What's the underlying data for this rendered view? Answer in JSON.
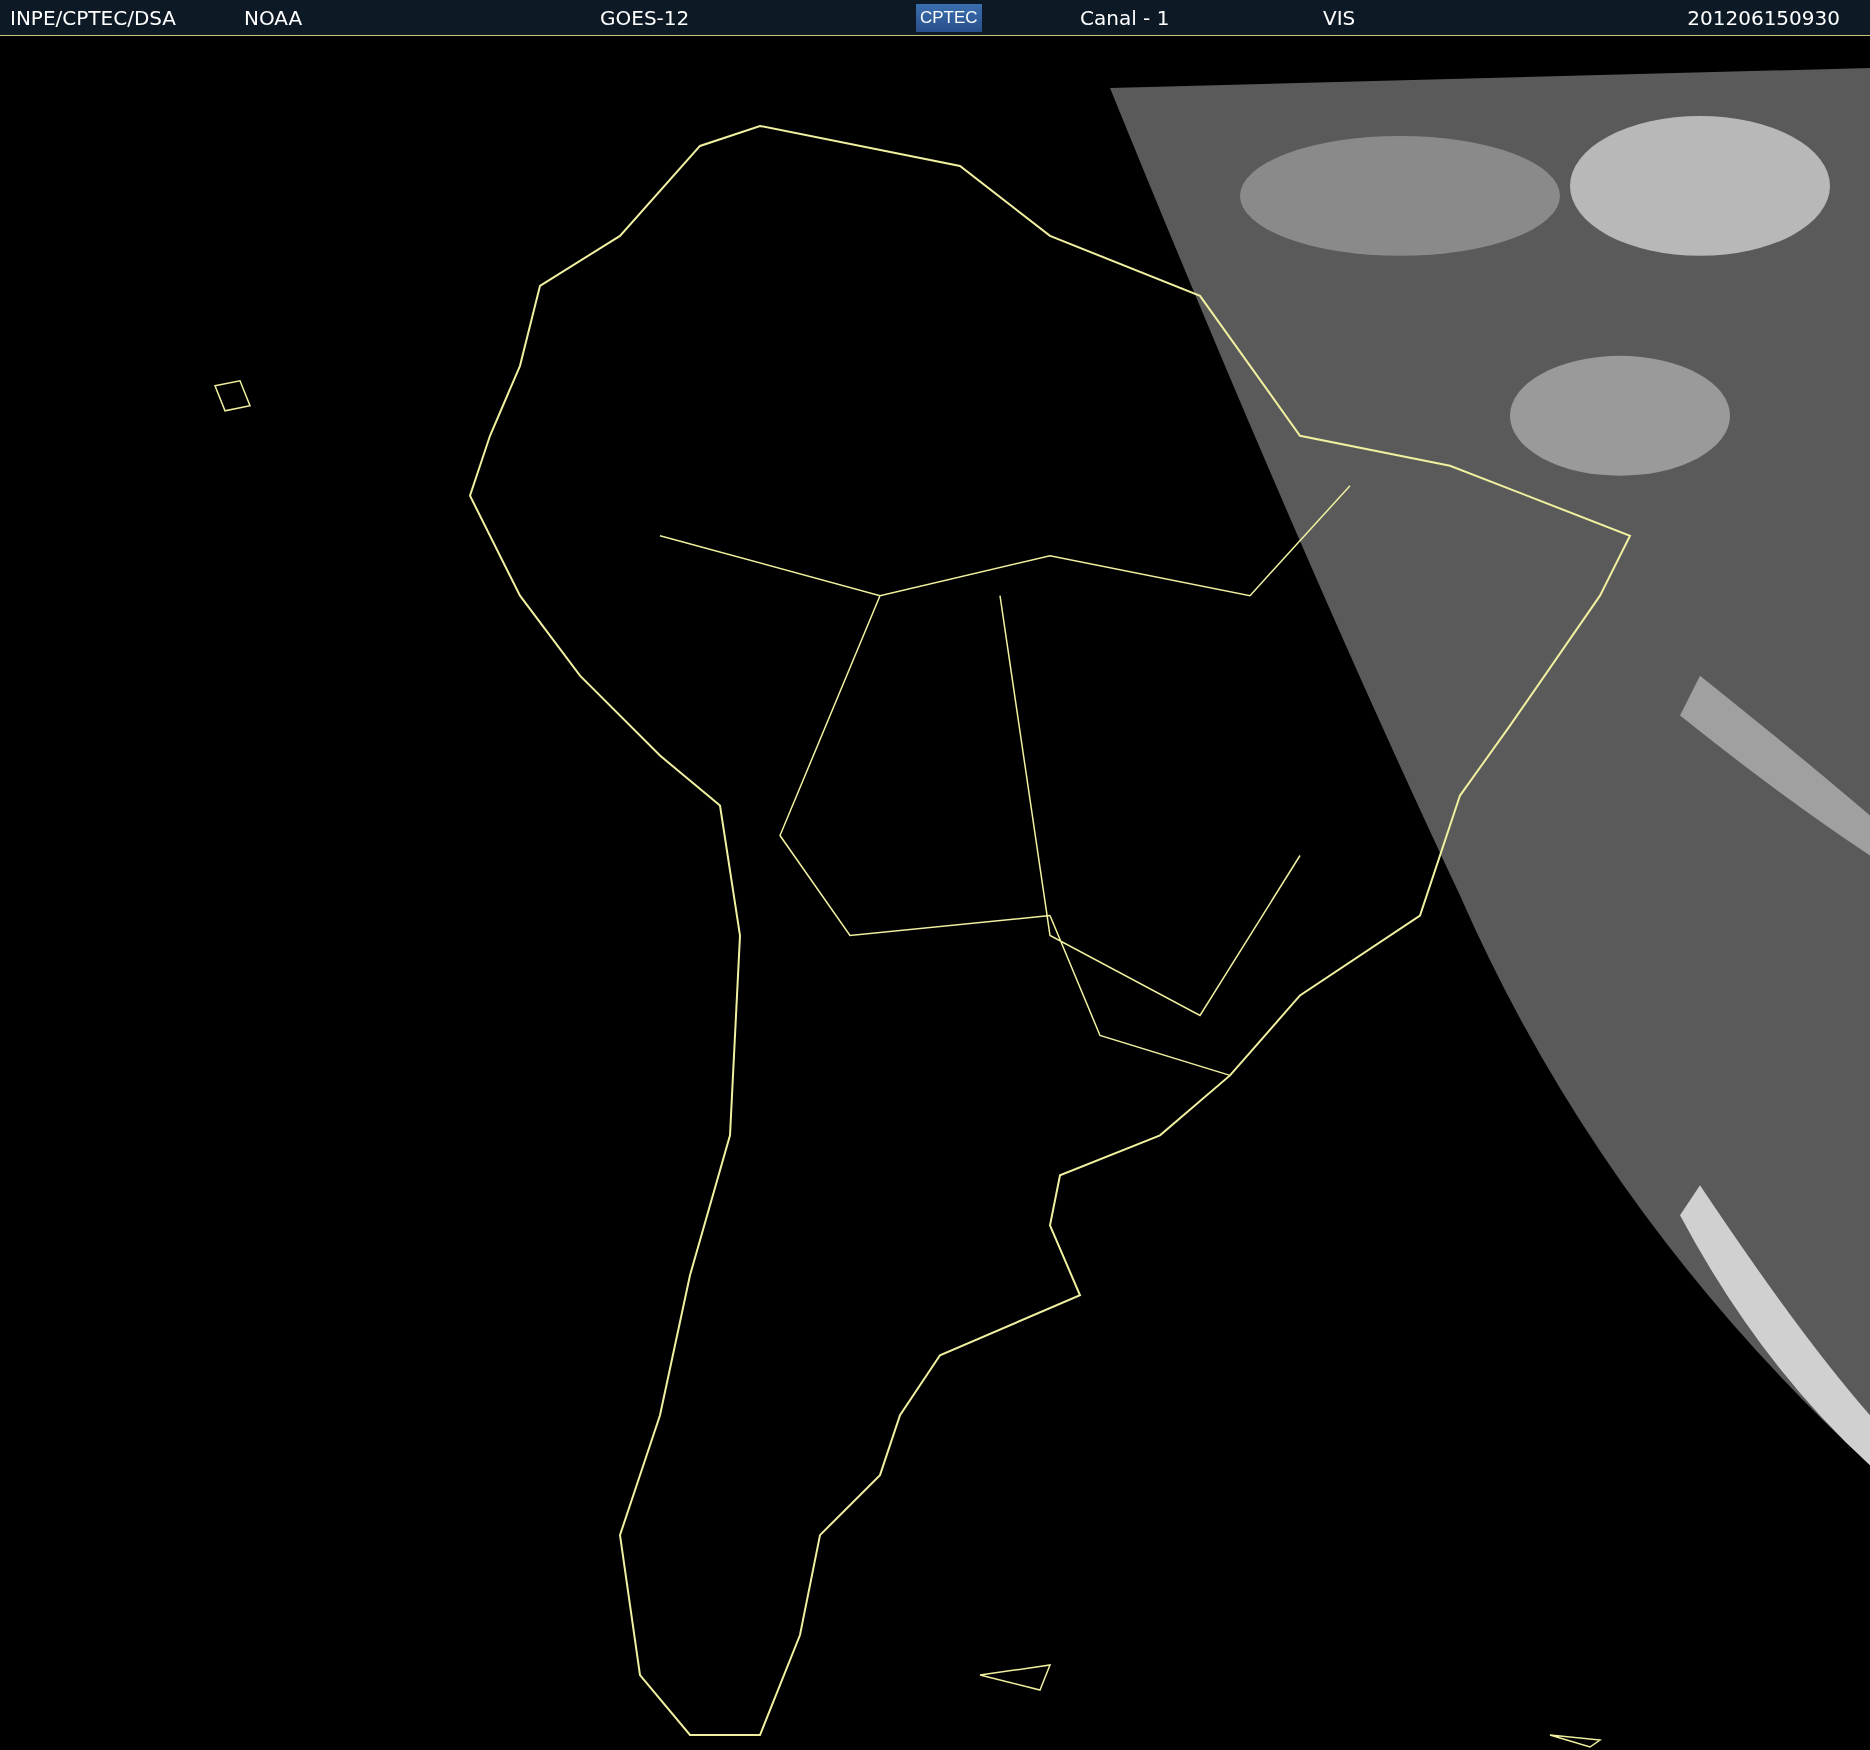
{
  "header": {
    "source": "INPE/CPTEC/DSA",
    "agency": "NOAA",
    "satellite": "GOES-12",
    "logo": "CPTEC",
    "channel": "Canal - 1",
    "band": "VIS",
    "timestamp": "201206150930"
  }
}
